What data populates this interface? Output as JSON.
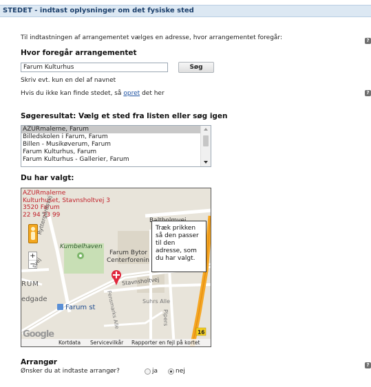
{
  "header": {
    "title": "STEDET - indtast oplysninger om det fysiske sted"
  },
  "intro": {
    "text": "Til indtastningen af arrangementet vælges en adresse, hvor arrangementet foregår:"
  },
  "location": {
    "heading": "Hvor foregår arrangementet",
    "input_value": "Farum Kulturhus",
    "search_label": "Søg",
    "hint": "Skriv evt. kun en del af navnet",
    "not_found_prefix": "Hvis du ikke kan finde stedet, så",
    "not_found_link": "opret",
    "not_found_suffix": "det her"
  },
  "results": {
    "heading": "Søgeresultat: Vælg et sted fra listen eller søg igen",
    "options": [
      "AZURmalerne, Farum",
      "Billedskolen i Farum, Farum",
      "Billen - Musikøverum, Farum",
      "Farum Kulturhus, Farum",
      "Farum Kulturhus - Gallerier, Farum"
    ],
    "selected_index": 0
  },
  "chosen": {
    "heading": "Du har valgt:",
    "address_lines": [
      "AZURmalerne",
      "Kulturhuset, Stavnsholtvej 3",
      "3520 Farum",
      "22 94 73 99"
    ]
  },
  "map": {
    "tooltip_lines": [
      "Træk prikken",
      "så den passer",
      "til den",
      "adresse, som",
      "du har valgt."
    ],
    "labels": {
      "kumbelhaven": "Kumbelhaven",
      "farum_bytorv_1": "Farum Bytor",
      "farum_bytorv_2": "Centerforenin",
      "stavnsholtvej": "Stavnsholtvej",
      "baltholmvej": "Baltholmvej",
      "rum": "RUM",
      "edgade": "edgade",
      "farum_st": "Farum st",
      "suhrs_alle": "Suhrs Alle",
      "fensmarks_alle": "Fensmarks Alle",
      "pipers": "Pipers",
      "ryttergardsvej": "Ryttergårdsvej",
      "svej": "svej",
      "route": "16",
      "google": "Google"
    },
    "zoom_in": "+",
    "zoom_out": "−",
    "footer": {
      "mapdata": "Kortdata",
      "terms": "Servicevilkår",
      "report": "Rapporter en fejl på kortet"
    },
    "colors": {
      "road_major": "#f5a623",
      "water": "#a8c8e8",
      "park": "#c8dfb5",
      "marker": "#e0263c"
    }
  },
  "organizer": {
    "heading": "Arrangør",
    "question": "Ønsker du at indtaste arrangør?",
    "yes": "ja",
    "no": "nej",
    "selected": "nej"
  },
  "help_icon": "?"
}
